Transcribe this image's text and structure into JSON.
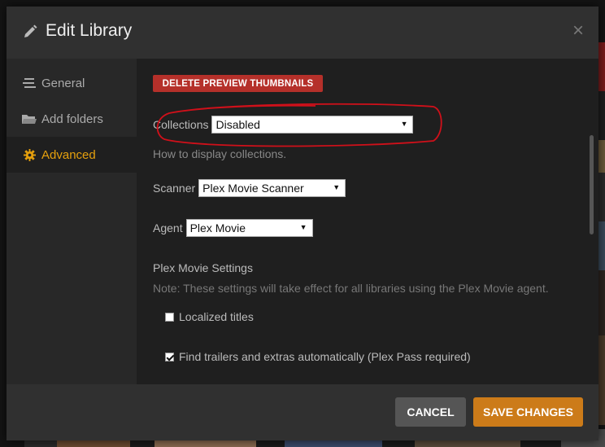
{
  "dialog": {
    "title": "Edit Library",
    "close_symbol": "×"
  },
  "sidebar": {
    "items": [
      {
        "label": "General",
        "icon": "list-icon",
        "active": false
      },
      {
        "label": "Add folders",
        "icon": "folder-icon",
        "active": false
      },
      {
        "label": "Advanced",
        "icon": "gear-icon",
        "active": true
      }
    ]
  },
  "advanced": {
    "delete_thumbnails_label": "DELETE PREVIEW THUMBNAILS",
    "collections": {
      "label": "Collections",
      "value": "Disabled",
      "help": "How to display collections."
    },
    "scanner": {
      "label": "Scanner",
      "value": "Plex Movie Scanner"
    },
    "agent": {
      "label": "Agent",
      "value": "Plex Movie"
    },
    "agent_settings": {
      "title": "Plex Movie Settings",
      "note": "Note: These settings will take effect for all libraries using the Plex Movie agent.",
      "options": [
        {
          "label": "Localized titles",
          "checked": false
        },
        {
          "label": "Find trailers and extras automatically (Plex Pass required)",
          "checked": true
        }
      ]
    }
  },
  "footer": {
    "cancel_label": "CANCEL",
    "save_label": "SAVE CHANGES"
  },
  "colors": {
    "accent": "#e5a00d",
    "save": "#cc7b19",
    "danger": "#b5302a",
    "annotation": "#d0101a"
  }
}
